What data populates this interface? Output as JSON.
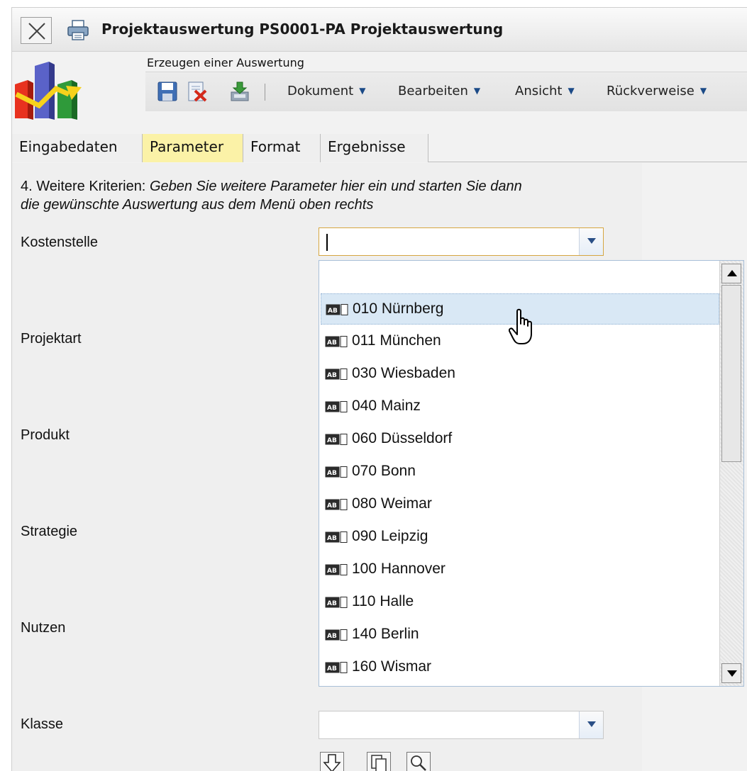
{
  "window": {
    "title": "Projektauswertung PS0001-PA Projektauswertung"
  },
  "header": {
    "caption": "Erzeugen einer Auswertung"
  },
  "toolbar": {
    "menus": [
      {
        "label": "Dokument"
      },
      {
        "label": "Bearbeiten"
      },
      {
        "label": "Ansicht"
      },
      {
        "label": "Rückverweise"
      }
    ]
  },
  "tabs": [
    {
      "label": "Eingabedaten",
      "active": false
    },
    {
      "label": "Parameter",
      "active": true
    },
    {
      "label": "Format",
      "active": false
    },
    {
      "label": "Ergebnisse",
      "active": false
    }
  ],
  "instructions": {
    "prefix": "4. Weitere Kriterien: ",
    "line1_italic": "Geben Sie weitere Parameter hier ein und starten Sie dann",
    "line2_italic": "die gewünschte Auswertung aus dem Menü oben rechts"
  },
  "fields": [
    {
      "label": "Kostenstelle",
      "value": ""
    },
    {
      "label": "Projektart"
    },
    {
      "label": "Produkt"
    },
    {
      "label": "Strategie"
    },
    {
      "label": "Nutzen"
    },
    {
      "label": "Klasse",
      "value": ""
    }
  ],
  "dropdown": {
    "options": [
      {
        "label": "010 Nürnberg",
        "hover": true
      },
      {
        "label": "011 München"
      },
      {
        "label": "030 Wiesbaden"
      },
      {
        "label": "040 Mainz"
      },
      {
        "label": "060 Düsseldorf"
      },
      {
        "label": "070 Bonn"
      },
      {
        "label": "080 Weimar"
      },
      {
        "label": "090 Leipzig"
      },
      {
        "label": "100 Hannover"
      },
      {
        "label": "110 Halle"
      },
      {
        "label": "140 Berlin"
      },
      {
        "label": "160 Wismar"
      }
    ]
  },
  "icons": {
    "close": "close-icon",
    "print": "printer-icon",
    "save": "save-icon",
    "delete": "delete-icon",
    "export": "export-icon",
    "option_type": "text-value-icon",
    "cursor": "hand-pointer-icon"
  },
  "colors": {
    "active_tab": "#fbf2a7",
    "hover_option": "#d9e8f5",
    "focus_border": "#d6a640",
    "accent": "#2a4f86"
  }
}
